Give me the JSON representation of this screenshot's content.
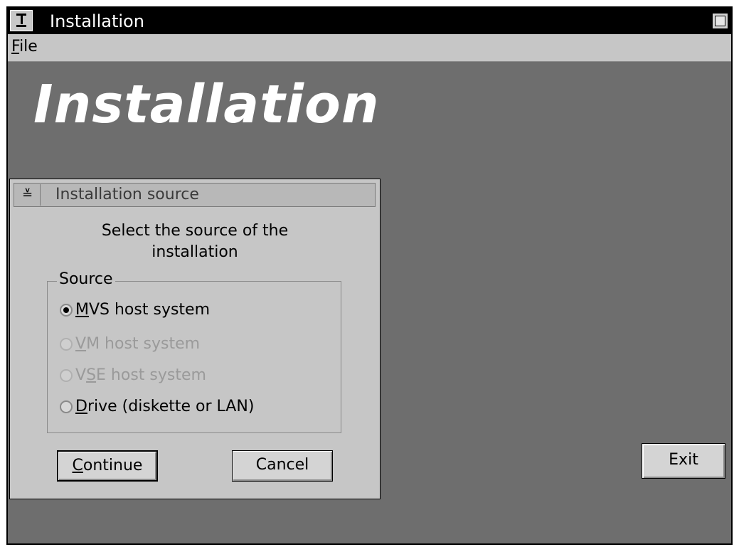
{
  "window": {
    "title": "Installation"
  },
  "menubar": {
    "file_prefix": "F",
    "file_rest": "ile"
  },
  "banner": {
    "title": "Installation"
  },
  "dialog": {
    "title": "Installation source",
    "sys_glyph": "≚",
    "instruction_line1": "Select the source of the",
    "instruction_line2": "installation",
    "group_label": "Source",
    "options": [
      {
        "mnemonic": "M",
        "rest": "VS host system",
        "checked": true,
        "enabled": true
      },
      {
        "mnemonic": "V",
        "rest": "M host system",
        "checked": false,
        "enabled": false
      },
      {
        "prefix": "V",
        "mnemonic": "S",
        "rest": "E host system",
        "checked": false,
        "enabled": false
      },
      {
        "mnemonic": "D",
        "rest": "rive (diskette or LAN)",
        "checked": false,
        "enabled": true
      }
    ],
    "continue": {
      "mnemonic": "C",
      "rest": "ontinue"
    },
    "cancel_label": "Cancel"
  },
  "exit_label": "Exit"
}
